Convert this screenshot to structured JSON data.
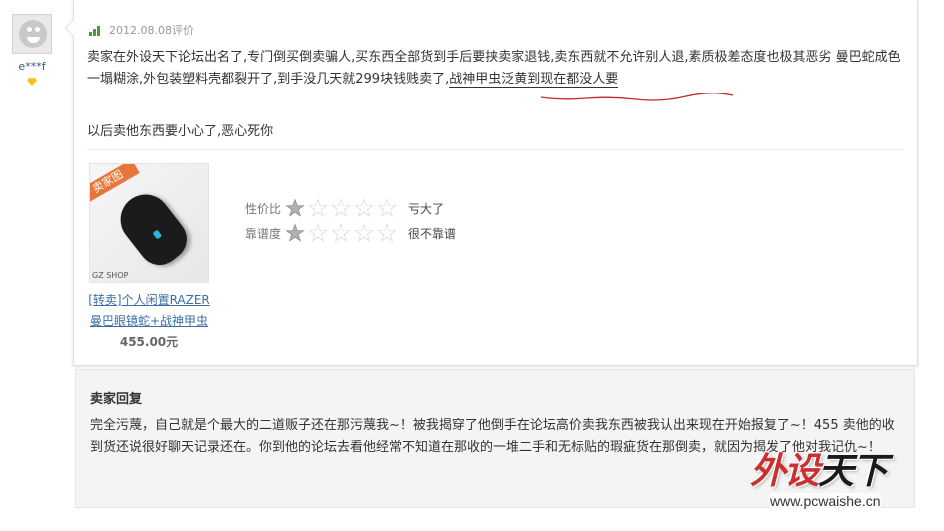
{
  "user": {
    "name": "e***f",
    "avatar_icon": "default-avatar-icon",
    "level_icon": "diamond-level-icon"
  },
  "review": {
    "date": "2012.08.08",
    "meta_label": "评价",
    "text_before_underline": "卖家在外设天下论坛出名了,专门倒买倒卖骗人,买东西全部货到手后要挟卖家退钱,卖东西就不允许别人退,素质极差态度也极其恶劣 曼巴蛇成色一塌糊涂,外包装塑料壳都裂开了,到手没几天就299块钱贱卖了,",
    "text_underlined": "战神甲虫泛黄到现在都没人要",
    "text_second": "以后卖他东西要小心了,恶心死你"
  },
  "product": {
    "tag": "卖家图",
    "image_caption": "GZ SHOP",
    "name": "[转卖]个人闲置RAZER曼巴眼镜蛇+战神甲虫",
    "price": "455.00元"
  },
  "ratings": [
    {
      "label": "性价比",
      "stars": 1,
      "max": 5,
      "text": "亏大了"
    },
    {
      "label": "靠谱度",
      "stars": 1,
      "max": 5,
      "text": "很不靠谱"
    }
  ],
  "seller_reply": {
    "title": "卖家回复",
    "text": "完全污蔑，自己就是个最大的二道贩子还在那污蔑我~！被我揭穿了他倒手在论坛高价卖我东西被我认出来现在开始报复了~！455 卖他的收到货还说很好聊天记录还在。你到他的论坛去看他经常不知道在那收的一堆二手和无标贴的瑕疵货在那倒卖，就因为揭发了他对我记仇~！"
  },
  "watermark": {
    "logo_red": "外设",
    "logo_dark": "天下",
    "url": "www.pcwaishe.cn"
  },
  "colors": {
    "link": "#3b6ea5",
    "squiggle": "#c0282a",
    "tag": "#e8753a"
  }
}
